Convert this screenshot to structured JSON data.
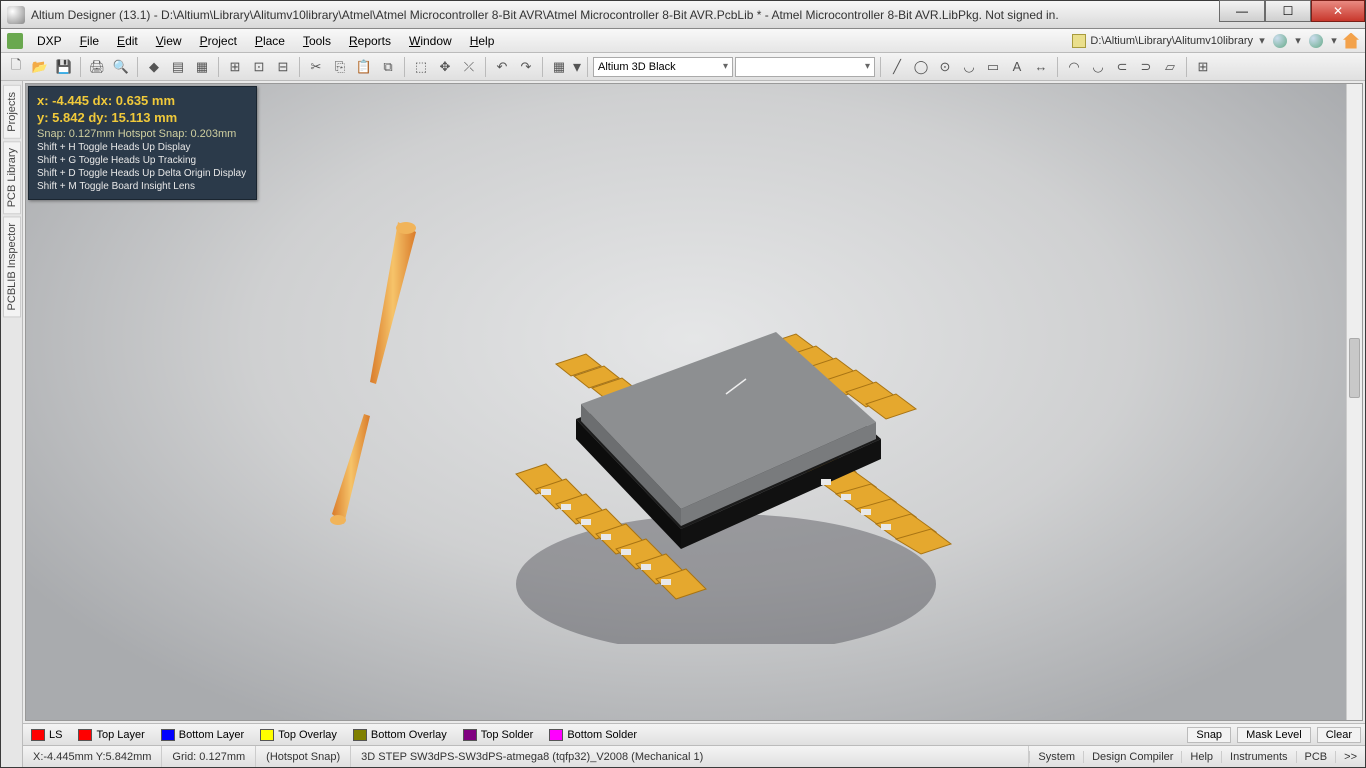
{
  "window": {
    "title": "Altium Designer (13.1) - D:\\Altium\\Library\\Alitumv10library\\Atmel\\Atmel Microcontroller 8-Bit AVR\\Atmel Microcontroller 8-Bit AVR.PcbLib * - Atmel Microcontroller 8-Bit AVR.LibPkg. Not signed in."
  },
  "menu": {
    "items": [
      "DXP",
      "File",
      "Edit",
      "View",
      "Project",
      "Place",
      "Tools",
      "Reports",
      "Window",
      "Help"
    ],
    "path": "D:\\Altium\\Library\\Alitumv10library"
  },
  "toolbar": {
    "viewConfig": "Altium 3D Black"
  },
  "sideTabs": [
    "Projects",
    "PCB Library",
    "PCBLIB Inspector"
  ],
  "hud": {
    "line1": "x: -4.445   dx:  0.635   mm",
    "line2": "y:  5.842   dy: 15.113   mm",
    "snap": "Snap: 0.127mm Hotspot Snap: 0.203mm",
    "hints": [
      "Shift + H   Toggle Heads Up Display",
      "Shift + G   Toggle Heads Up Tracking",
      "Shift + D   Toggle Heads Up Delta Origin Display",
      "Shift + M  Toggle Board Insight Lens"
    ]
  },
  "layers": [
    {
      "label": "LS",
      "color": "#ff0000"
    },
    {
      "label": "Top Layer",
      "color": "#ff0000"
    },
    {
      "label": "Bottom Layer",
      "color": "#0000ff"
    },
    {
      "label": "Top Overlay",
      "color": "#ffff00"
    },
    {
      "label": "Bottom Overlay",
      "color": "#808000"
    },
    {
      "label": "Top Solder",
      "color": "#800080"
    },
    {
      "label": "Bottom Solder",
      "color": "#ff00ff"
    }
  ],
  "layerButtons": [
    "Snap",
    "Mask Level",
    "Clear"
  ],
  "status": {
    "coords": "X:-4.445mm Y:5.842mm",
    "grid": "Grid: 0.127mm",
    "hotspot": "(Hotspot Snap)",
    "object": "3D STEP SW3dPS-SW3dPS-atmega8 (tqfp32)_V2008 (Mechanical 1)"
  },
  "panels": [
    "System",
    "Design Compiler",
    "Help",
    "Instruments",
    "PCB",
    ">>"
  ]
}
